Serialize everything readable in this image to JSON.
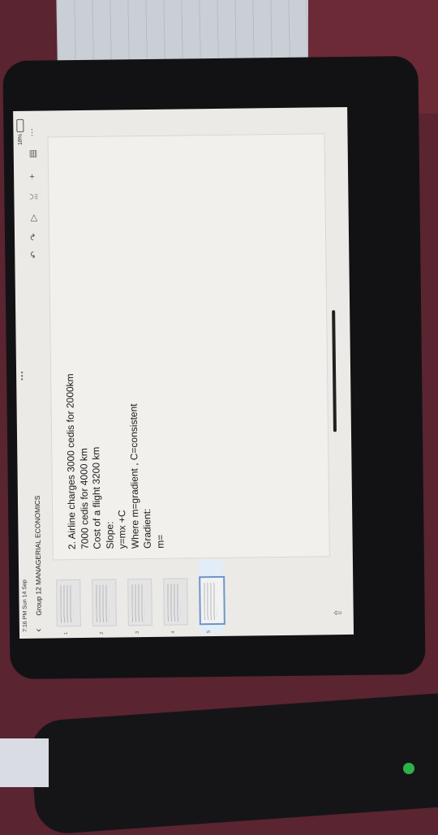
{
  "status": {
    "time_date": "7:16 PM  Sun 14 Sep",
    "battery": "18%"
  },
  "toolbar": {
    "back_icon": "chevron-left-icon",
    "doc_title": "Group 12 MANAGERIAL ECONOMICS",
    "more_dots": "•••",
    "undo": "↶",
    "redo": "↷",
    "play": "▷",
    "share": "ꈍ",
    "add": "+",
    "comment": "▤",
    "menu": "···"
  },
  "thumbnails": [
    {
      "num": "1"
    },
    {
      "num": "2"
    },
    {
      "num": "3"
    },
    {
      "num": "4"
    },
    {
      "num": "5"
    }
  ],
  "slide": {
    "lines": [
      "2. Airline charges 3000 cedis for 2000km",
      "7000 cedis for 4000 km",
      "Cost of a flight 3200 km",
      "Slope:",
      "y=mx +C",
      "Where m=gradient , C=consistent",
      "Gradient:",
      "m="
    ]
  },
  "bottom": {
    "add_slide": "⇧"
  }
}
